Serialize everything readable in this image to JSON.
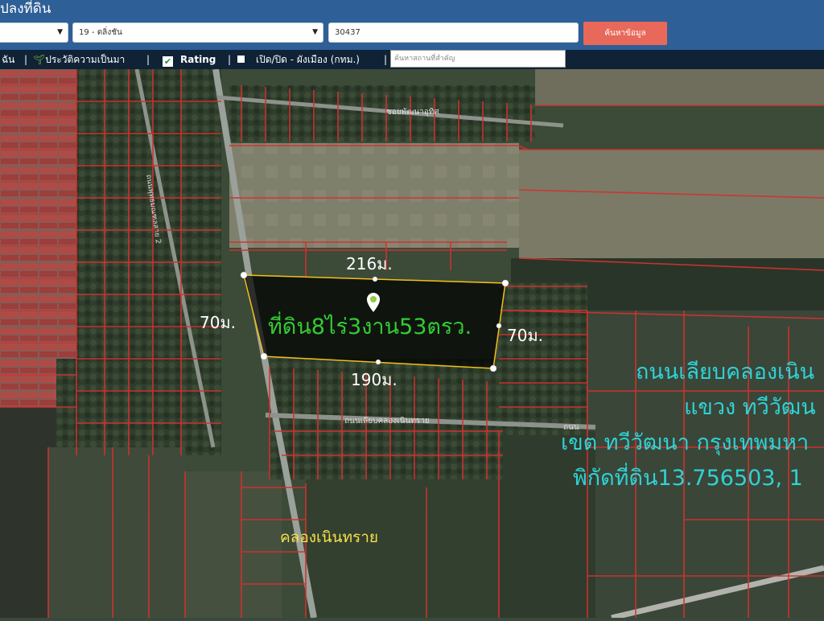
{
  "header": {
    "title": "ปลงที่ดิน",
    "province_select": "",
    "district_select": "19 - ตลิ่งชัน",
    "parcel_number": "30437",
    "search_button": "ค้นหาข้อมูล"
  },
  "toolbar": {
    "item_land": "ฉัน",
    "item_history": "ประวัติความเป็นมา",
    "item_rating": "Rating",
    "item_layer": "เปิด/ปิด - ผังเมือง (กทม.)",
    "place_search_placeholder": "ค้นหาสถานที่สำคัญ"
  },
  "map": {
    "area_label": "ที่ดิน8ไร่3งาน53ตรว.",
    "dimensions": {
      "top": "216ม.",
      "bottom": "190ม.",
      "left": "70ม.",
      "right": "70ม."
    },
    "address_lines": [
      "ถนนเลียบคลองเนิน",
      "แขวง ทวีวัฒน",
      "เขต ทวีวัฒนา กรุงเทพมหา",
      "พิกัดที่ดิน13.756503, 1"
    ],
    "canal_label": "คลองเนินทราย",
    "street_labels": {
      "soi_top": "ซอยพัฒนาอุทิศ",
      "road_bottom": "ถนนเลียบคลองเนินทราย",
      "road_bottom_2": "ถนน",
      "left_road": "ถนนพุทธมณฑลสาย 2"
    },
    "colors": {
      "parcel_line": "#d3312f",
      "plot_outline": "#f2c11a",
      "area_text": "#33cc33",
      "dimension_text": "#ffffff",
      "address_text": "#2fd2d6",
      "canal_text": "#f4e04a"
    }
  }
}
